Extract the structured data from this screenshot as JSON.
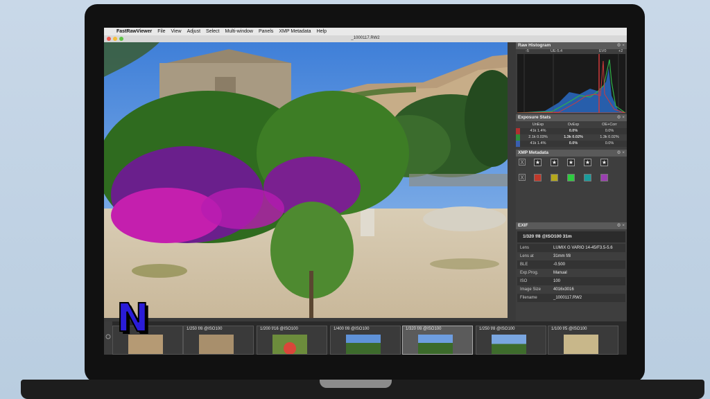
{
  "menubar": {
    "app_name": "FastRawViewer",
    "items": [
      "File",
      "View",
      "Adjust",
      "Select",
      "Multi-window",
      "Panels",
      "XMP Metadata",
      "Help"
    ]
  },
  "window": {
    "title": "_1000117.RW2"
  },
  "histogram": {
    "title": "Raw Histogram",
    "ticks": [
      "-5",
      "UE-5.4",
      "EV0",
      "+2"
    ]
  },
  "exposure_stats": {
    "title": "Exposure Stats",
    "columns": [
      "UnExp",
      "OvExp",
      "OE+Corr"
    ],
    "rows": [
      {
        "channel": "R",
        "unexp": "41k 1.4%",
        "ovexp": "0.0%",
        "oecorr": "0.0%"
      },
      {
        "channel": "G",
        "unexp": "2.1k 0.03%",
        "ovexp": "1.3k 0.02%",
        "oecorr": "1.3k 0.02%"
      },
      {
        "channel": "B",
        "unexp": "41k 1.4%",
        "ovexp": "0.0%",
        "oecorr": "0.0%"
      }
    ],
    "channel_colors": [
      "#b03030",
      "#2f8f3a",
      "#3a5fb0"
    ]
  },
  "xmp": {
    "title": "XMP Metadata",
    "reject_label": "X",
    "star_glyph": "★",
    "color_labels": [
      "#c0392b",
      "#b5a81c",
      "#2ecc40",
      "#1a9c9c",
      "#9b3fb0"
    ]
  },
  "exif": {
    "title": "EXIF",
    "shot": "1/320 f/8 @ISO100 31m",
    "rows": [
      {
        "k": "Lens",
        "v": "LUMIX G VARIO 14-45/F3.5-5.6"
      },
      {
        "k": "Lens at",
        "v": "31mm f/8"
      },
      {
        "k": "BLE",
        "v": "-0.500"
      },
      {
        "k": "Exp.Prog.",
        "v": "Manual"
      },
      {
        "k": "ISO",
        "v": "100"
      },
      {
        "k": "Image Size",
        "v": "4016x3016"
      },
      {
        "k": "Filename",
        "v": "_1000117.RW2"
      }
    ]
  },
  "filmstrip": {
    "thumbs": [
      {
        "caption": "1/250 f/8 @ISO100"
      },
      {
        "caption": "1/200 f/16 @ISO100"
      },
      {
        "caption": "1/400 f/8 @ISO100"
      },
      {
        "caption": "1/320 f/8 @ISO100",
        "selected": true
      },
      {
        "caption": "1/250 f/8 @ISO100"
      },
      {
        "caption": "1/100 f/5 @ISO100"
      }
    ]
  },
  "overlay_logo": {
    "letter": "N",
    "color": "#2a1cd8"
  }
}
